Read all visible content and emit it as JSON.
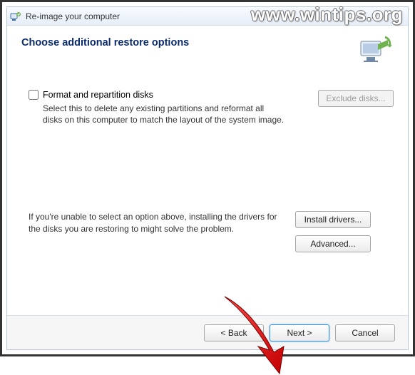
{
  "window": {
    "title": "Re-image your computer"
  },
  "header": {
    "title": "Choose additional restore options"
  },
  "options": {
    "format": {
      "label": "Format and repartition disks",
      "description": "Select this to delete any existing partitions and reformat all disks on this computer to match the layout of the system image.",
      "exclude_button": "Exclude disks..."
    },
    "drivers": {
      "text": "If you're unable to select an option above, installing the drivers for the disks you are restoring to might solve the problem.",
      "install_button": "Install drivers...",
      "advanced_button": "Advanced..."
    }
  },
  "footer": {
    "back": "< Back",
    "next": "Next >",
    "cancel": "Cancel"
  },
  "watermark": "www.wintips.org"
}
